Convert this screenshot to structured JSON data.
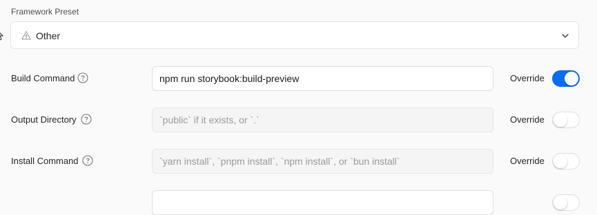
{
  "framework_preset": {
    "label": "Framework Preset",
    "value": "Other",
    "icon": "warning-triangle-icon"
  },
  "fields": [
    {
      "label": "Build Command",
      "value": "npm run storybook:build-preview",
      "placeholder": "",
      "override_label": "Override",
      "override_enabled": true
    },
    {
      "label": "Output Directory",
      "value": "",
      "placeholder": "`public` if it exists, or `.`",
      "override_label": "Override",
      "override_enabled": false
    },
    {
      "label": "Install Command",
      "value": "",
      "placeholder": "`yarn install`, `pnpm install`, `npm install`, or `bun install`",
      "override_label": "Override",
      "override_enabled": false
    }
  ],
  "colors": {
    "toggle_on": "#0a6cf0"
  }
}
